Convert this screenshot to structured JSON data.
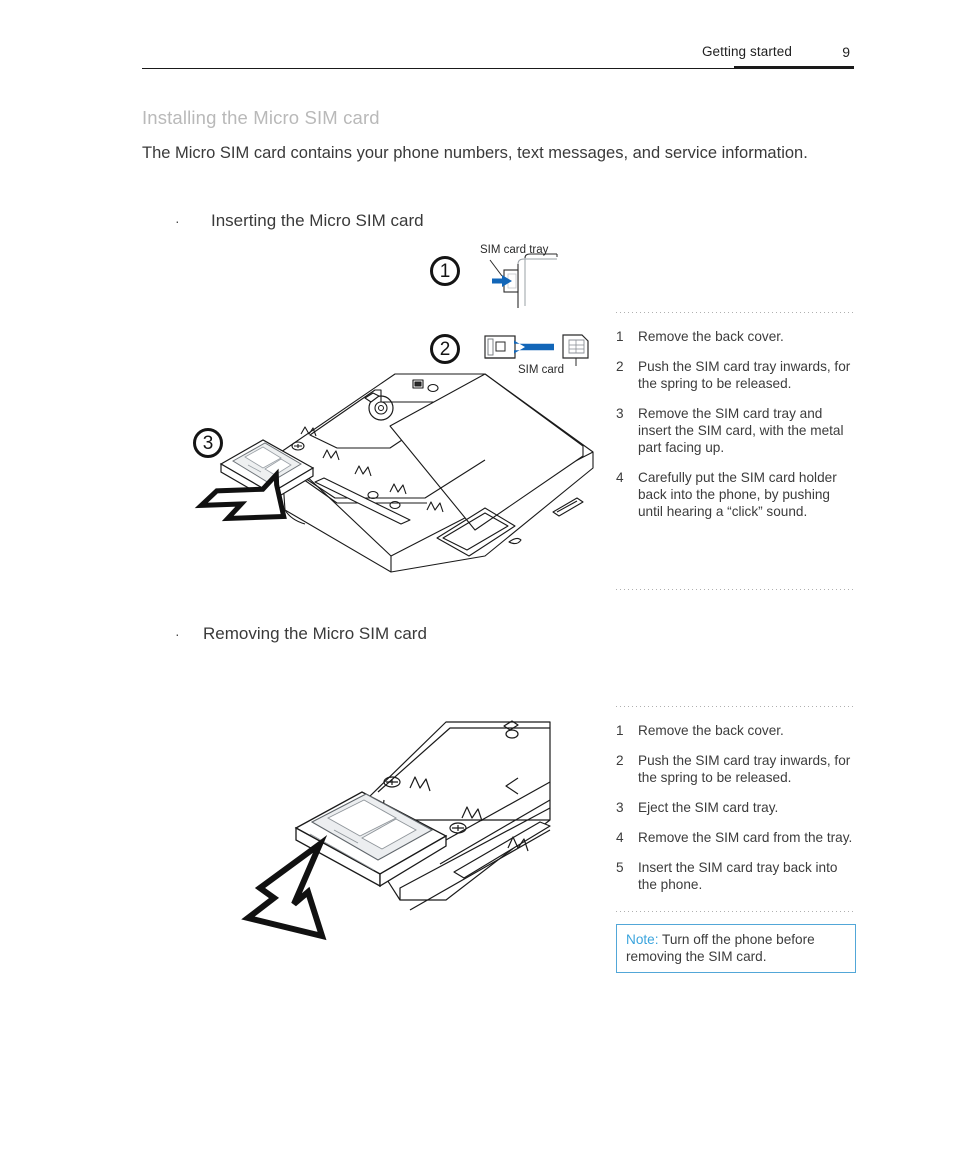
{
  "header": {
    "title": "Getting started",
    "page_number": "9"
  },
  "section": {
    "title": "Installing the Micro SIM card",
    "intro": "The Micro SIM card contains your phone numbers, text messages, and service information."
  },
  "bullets": {
    "insert": {
      "marker": "·",
      "label": "Inserting the Micro SIM card"
    },
    "remove": {
      "marker": "·",
      "label": "Removing the Micro SIM card"
    }
  },
  "figures": {
    "step1": {
      "circle_number": "1",
      "callout": "SIM card tray"
    },
    "step2": {
      "circle_number": "2",
      "callout": "SIM card"
    },
    "step3": {
      "circle_number": "3"
    }
  },
  "insert_steps": [
    {
      "num": "1",
      "text": "Remove the back cover."
    },
    {
      "num": "2",
      "text": "Push the SIM card tray inwards, for the spring to be released."
    },
    {
      "num": "3",
      "text": "Remove the SIM card tray and insert the SIM card, with the metal part facing up."
    },
    {
      "num": "4",
      "text": "Carefully put the SIM card holder back into the phone, by pushing until hearing a  “click” sound."
    }
  ],
  "remove_steps": [
    {
      "num": "1",
      "text": "Remove the back cover."
    },
    {
      "num": "2",
      "text": "Push the SIM card tray inwards, for the spring to be released."
    },
    {
      "num": "3",
      "text": "Eject the SIM card tray."
    },
    {
      "num": "4",
      "text": "Remove the SIM card from the tray."
    },
    {
      "num": "5",
      "text": "Insert the SIM card tray back into the phone."
    }
  ],
  "note": {
    "label": "Note:",
    "text": " Turn off the phone before removing the SIM card."
  },
  "colors": {
    "accent_blue": "#3ba4dd",
    "arrow_blue": "#1266b8",
    "heading_gray": "#b9b9b9",
    "body": "#3a3a3a"
  }
}
